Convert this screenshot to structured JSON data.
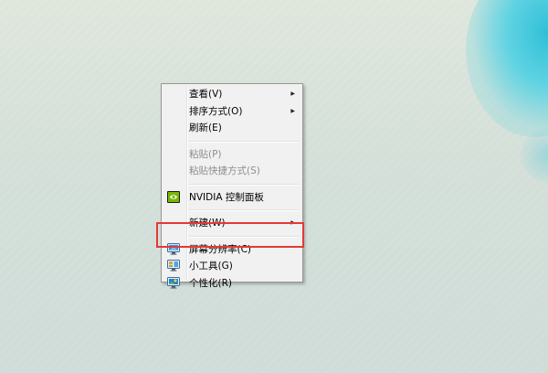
{
  "context_menu": {
    "items": [
      {
        "label": "查看(V)",
        "has_submenu": true,
        "disabled": false
      },
      {
        "label": "排序方式(O)",
        "has_submenu": true,
        "disabled": false
      },
      {
        "label": "刷新(E)",
        "has_submenu": false,
        "disabled": false
      },
      {
        "label": "粘贴(P)",
        "has_submenu": false,
        "disabled": true
      },
      {
        "label": "粘贴快捷方式(S)",
        "has_submenu": false,
        "disabled": true
      },
      {
        "label": "NVIDIA 控制面板",
        "has_submenu": false,
        "disabled": false,
        "icon": "nvidia-icon"
      },
      {
        "label": "新建(W)",
        "has_submenu": true,
        "disabled": false
      },
      {
        "label": "屏幕分辨率(C)",
        "has_submenu": false,
        "disabled": false,
        "icon": "monitor-icon",
        "highlighted": true
      },
      {
        "label": "小工具(G)",
        "has_submenu": false,
        "disabled": false,
        "icon": "gadgets-icon"
      },
      {
        "label": "个性化(R)",
        "has_submenu": false,
        "disabled": false,
        "icon": "personalize-icon"
      }
    ],
    "submenu_arrow": "▶"
  },
  "colors": {
    "highlight_border": "#e53935",
    "menu_background": "#f1f1f1",
    "disabled_text": "#8d8d8d"
  }
}
